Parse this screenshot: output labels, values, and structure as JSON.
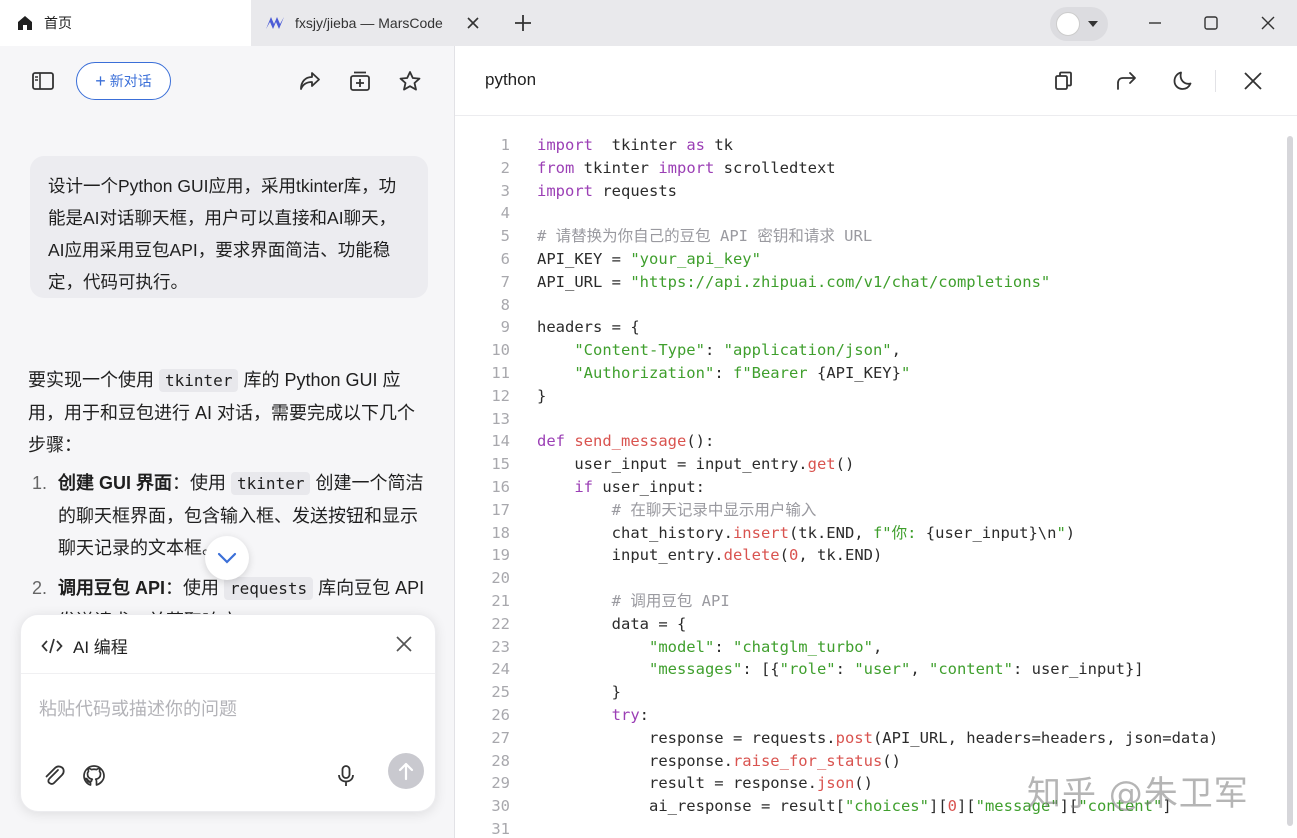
{
  "tabs": [
    {
      "title": "首页",
      "icon": "home-icon",
      "active": true
    },
    {
      "title": "fxsjy/jieba — MarsCode",
      "icon": "marscode-logo-icon",
      "active": false
    }
  ],
  "left": {
    "new_chat_label": "新对话",
    "user_message": "设计一个Python GUI应用，采用tkinter库，功能是AI对话聊天框，用户可以直接和AI聊天，AI应用采用豆包API，要求界面简洁、功能稳定，代码可执行。",
    "answer": {
      "intro_before": "要实现一个使用",
      "intro_code": "tkinter",
      "intro_after": "库的 Python GUI 应用，用于和豆包进行 AI 对话，需要完成以下几个步骤：",
      "steps": [
        {
          "num": "1.",
          "title": "创建 GUI 界面",
          "before": "：使用",
          "code": "tkinter",
          "after": "创建一个简洁的聊天框界面，包含输入框、发送按钮和显示聊天记录的文本框。"
        },
        {
          "num": "2.",
          "title": "调用豆包 API",
          "before": "：使用",
          "code": "requests",
          "after": "库向豆包 API 发送请求，并获取响应。"
        }
      ]
    },
    "composer": {
      "mode_label": "AI 编程",
      "placeholder": "粘贴代码或描述你的问题"
    }
  },
  "right": {
    "language": "python",
    "code_lines": [
      [
        [
          "kw",
          "import"
        ],
        [
          "",
          "  tkinter "
        ],
        [
          "kw",
          "as"
        ],
        [
          "",
          " tk"
        ]
      ],
      [
        [
          "kw",
          "from"
        ],
        [
          "",
          " tkinter "
        ],
        [
          "kw",
          "import"
        ],
        [
          "",
          " scrolledtext"
        ]
      ],
      [
        [
          "kw",
          "import"
        ],
        [
          "",
          " requests"
        ]
      ],
      [],
      [
        [
          "cm",
          "# 请替换为你自己的豆包 API 密钥和请求 URL"
        ]
      ],
      [
        [
          "",
          "API_KEY = "
        ],
        [
          "str",
          "\"your_api_key\""
        ]
      ],
      [
        [
          "",
          "API_URL = "
        ],
        [
          "str",
          "\"https://api.zhipuai.com/v1/chat/completions\""
        ]
      ],
      [],
      [
        [
          "",
          "headers = {"
        ]
      ],
      [
        [
          "",
          "    "
        ],
        [
          "str",
          "\"Content-Type\""
        ],
        [
          "",
          ": "
        ],
        [
          "str",
          "\"application/json\""
        ],
        [
          "",
          ","
        ]
      ],
      [
        [
          "",
          "    "
        ],
        [
          "str",
          "\"Authorization\""
        ],
        [
          "",
          ": "
        ],
        [
          "str",
          "f\"Bearer "
        ],
        [
          "",
          "{API_KEY}"
        ],
        [
          "str",
          "\""
        ]
      ],
      [
        [
          "",
          "}"
        ]
      ],
      [],
      [
        [
          "kw",
          "def"
        ],
        [
          "",
          " "
        ],
        [
          "fn",
          "send_message"
        ],
        [
          "",
          "():"
        ]
      ],
      [
        [
          "",
          "    user_input = input_entry."
        ],
        [
          "fn",
          "get"
        ],
        [
          "",
          "()"
        ]
      ],
      [
        [
          "",
          "    "
        ],
        [
          "kw",
          "if"
        ],
        [
          "",
          " user_input:"
        ]
      ],
      [
        [
          "",
          "        "
        ],
        [
          "cm",
          "# 在聊天记录中显示用户输入"
        ]
      ],
      [
        [
          "",
          "        chat_history."
        ],
        [
          "fn",
          "insert"
        ],
        [
          "",
          "(tk.END, "
        ],
        [
          "str",
          "f\"你: "
        ],
        [
          "",
          "{user_input}\\n"
        ],
        [
          "str",
          "\""
        ],
        [
          "",
          ")"
        ]
      ],
      [
        [
          "",
          "        input_entry."
        ],
        [
          "fn",
          "delete"
        ],
        [
          "",
          "("
        ],
        [
          "num",
          "0"
        ],
        [
          "",
          ", tk.END)"
        ]
      ],
      [],
      [
        [
          "",
          "        "
        ],
        [
          "cm",
          "# 调用豆包 API"
        ]
      ],
      [
        [
          "",
          "        data = {"
        ]
      ],
      [
        [
          "",
          "            "
        ],
        [
          "str",
          "\"model\""
        ],
        [
          "",
          ": "
        ],
        [
          "str",
          "\"chatglm_turbo\""
        ],
        [
          "",
          ","
        ]
      ],
      [
        [
          "",
          "            "
        ],
        [
          "str",
          "\"messages\""
        ],
        [
          "",
          ": [{"
        ],
        [
          "str",
          "\"role\""
        ],
        [
          "",
          ": "
        ],
        [
          "str",
          "\"user\""
        ],
        [
          "",
          ", "
        ],
        [
          "str",
          "\"content\""
        ],
        [
          "",
          ": user_input}]"
        ]
      ],
      [
        [
          "",
          "        }"
        ]
      ],
      [
        [
          "",
          "        "
        ],
        [
          "kw",
          "try"
        ],
        [
          "",
          ":"
        ]
      ],
      [
        [
          "",
          "            response = requests."
        ],
        [
          "fn",
          "post"
        ],
        [
          "",
          "(API_URL, headers=headers, json=data)"
        ]
      ],
      [
        [
          "",
          "            response."
        ],
        [
          "fn",
          "raise_for_status"
        ],
        [
          "",
          "()"
        ]
      ],
      [
        [
          "",
          "            result = response."
        ],
        [
          "fn",
          "json"
        ],
        [
          "",
          "()"
        ]
      ],
      [
        [
          "",
          "            ai_response = result["
        ],
        [
          "str",
          "\"choices\""
        ],
        [
          "",
          "]["
        ],
        [
          "num",
          "0"
        ],
        [
          "",
          "]["
        ],
        [
          "str",
          "\"message\""
        ],
        [
          "",
          "]["
        ],
        [
          "str",
          "\"content\""
        ],
        [
          "",
          "]"
        ]
      ],
      []
    ]
  },
  "watermark": "知乎 @朱卫军"
}
